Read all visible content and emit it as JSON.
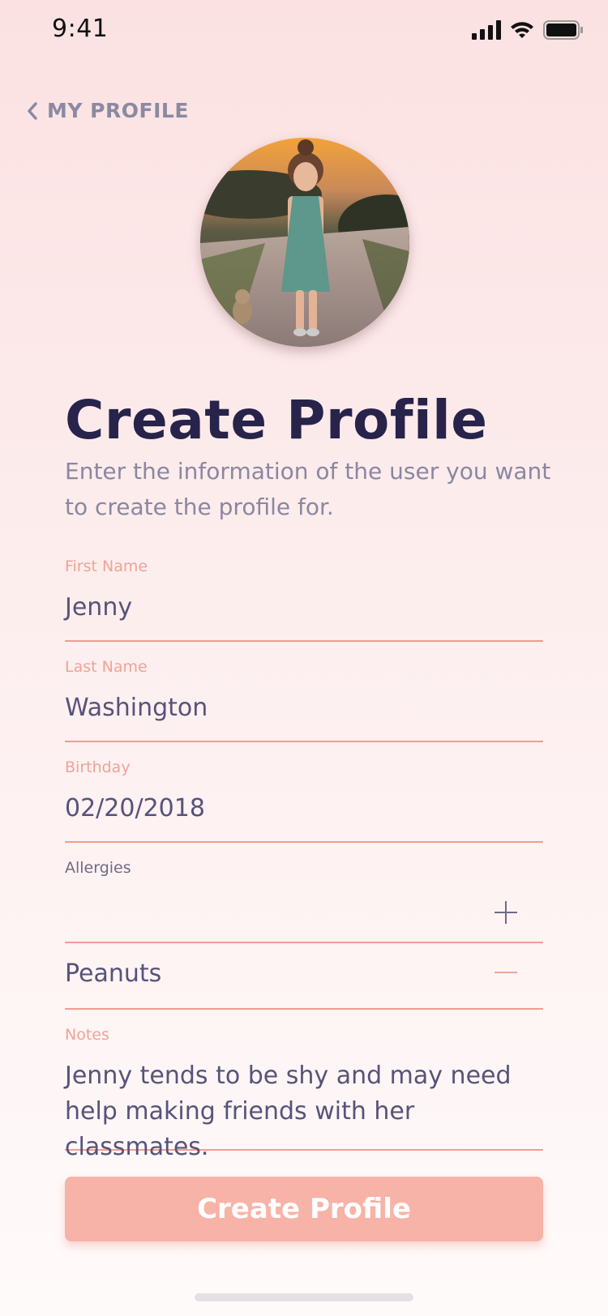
{
  "status_bar": {
    "time": "9:41"
  },
  "nav": {
    "back_label": "MY PROFILE"
  },
  "page": {
    "title": "Create Profile",
    "subtitle": "Enter the information of the user you want to create the profile for."
  },
  "form": {
    "first_name": {
      "label": "First Name",
      "value": "Jenny"
    },
    "last_name": {
      "label": "Last Name",
      "value": "Washington"
    },
    "birthday": {
      "label": "Birthday",
      "value": "02/20/2018"
    },
    "allergies": {
      "label": "Allergies",
      "items": [
        "Peanuts"
      ]
    },
    "notes": {
      "label": "Notes",
      "value": "Jenny tends to be shy and may need help making friends with her classmates."
    }
  },
  "actions": {
    "submit_label": "Create Profile"
  },
  "colors": {
    "accent": "#f7b3a7",
    "divider": "#ee9e92",
    "title": "#27234a",
    "muted": "#8b87a0"
  },
  "icons": {
    "back": "chevron-left-icon",
    "add": "plus-icon",
    "remove": "minus-icon",
    "signal": "cellular-signal-icon",
    "wifi": "wifi-icon",
    "battery": "battery-icon"
  }
}
